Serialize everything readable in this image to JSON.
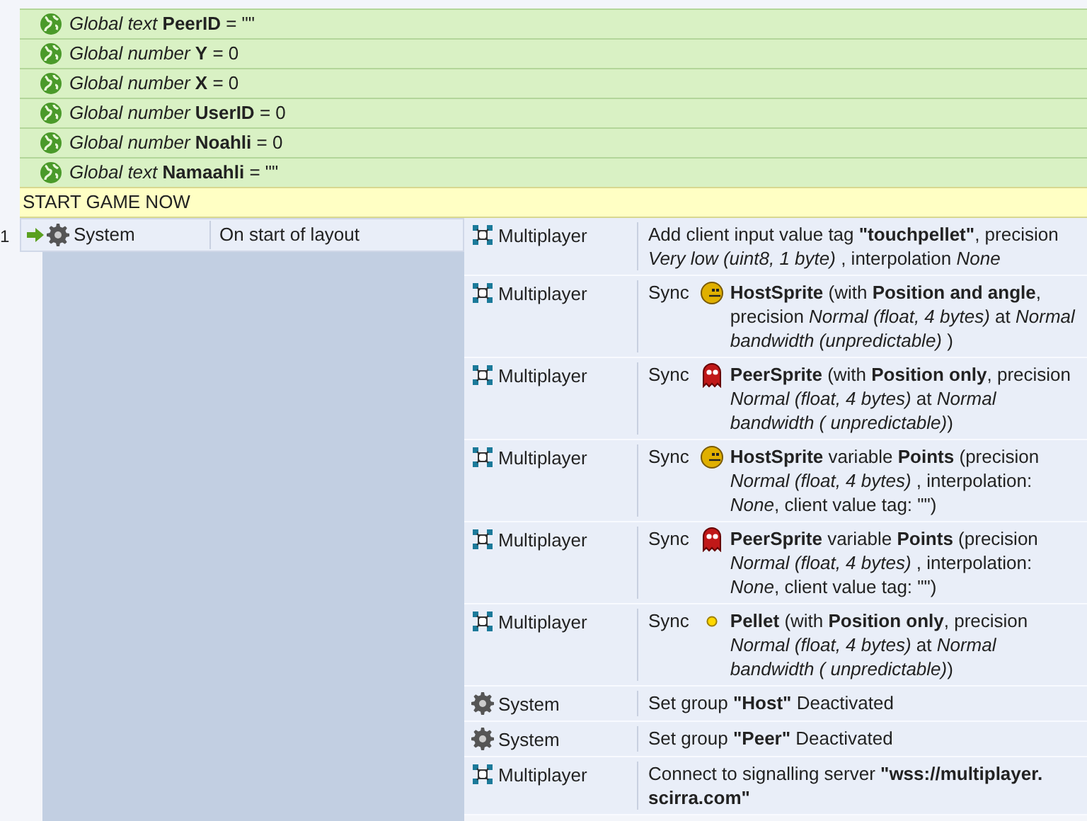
{
  "globals": [
    {
      "text": "*Global text* **PeerID** = \"\""
    },
    {
      "text": "*Global number* **Y** = 0"
    },
    {
      "text": "*Global number* **X** = 0"
    },
    {
      "text": "*Global number* **UserID** = 0"
    },
    {
      "text": "*Global number* **Noahli** = 0"
    },
    {
      "text": "*Global text* **Namaahli** = \"\""
    }
  ],
  "comment": "START GAME NOW",
  "event": {
    "number": "1",
    "condition": {
      "object": "System",
      "object_icon": {
        "kind": "system"
      },
      "text": "On start of layout"
    },
    "actions": [
      {
        "object": "Multiplayer",
        "object_icon": {
          "kind": "multiplayer"
        },
        "text": "Add client input value tag **\"touchpellet\"**, precision *Very low (uint8, 1 byte)* , interpolation *None*"
      },
      {
        "object": "Multiplayer",
        "object_icon": {
          "kind": "multiplayer"
        },
        "prefix": "Sync",
        "sprite": {
          "kind": "host"
        },
        "text": "**HostSprite** (with **Position and angle**, precision *Normal (float, 4 bytes)*  at *Normal bandwidth (unpredictable)* )"
      },
      {
        "object": "Multiplayer",
        "object_icon": {
          "kind": "multiplayer"
        },
        "prefix": "Sync",
        "sprite": {
          "kind": "peer"
        },
        "text": "**PeerSprite** (with **Position only**, precision *Normal (float, 4 bytes)*  at *Normal bandwidth ( unpredictable)*)"
      },
      {
        "object": "Multiplayer",
        "object_icon": {
          "kind": "multiplayer"
        },
        "prefix": "Sync",
        "sprite": {
          "kind": "host"
        },
        "text": "**HostSprite** variable **Points** (precision *Normal (float, 4 bytes)* , interpolation: *None*, client value tag: \"\")"
      },
      {
        "object": "Multiplayer",
        "object_icon": {
          "kind": "multiplayer"
        },
        "prefix": "Sync",
        "sprite": {
          "kind": "peer"
        },
        "text": "**PeerSprite** variable **Points** (precision *Normal (float, 4 bytes)* , interpolation: *None*, client value tag: \"\")"
      },
      {
        "object": "Multiplayer",
        "object_icon": {
          "kind": "multiplayer"
        },
        "prefix": "Sync",
        "sprite": {
          "kind": "pellet"
        },
        "text": "**Pellet** (with **Position only**, precision *Normal (float, 4 bytes)*  at *Normal bandwidth ( unpredictable)*)"
      },
      {
        "object": "System",
        "object_icon": {
          "kind": "system"
        },
        "text": "Set group **\"Host\"** Deactivated"
      },
      {
        "object": "System",
        "object_icon": {
          "kind": "system"
        },
        "text": "Set group **\"Peer\"** Deactivated"
      },
      {
        "object": "Multiplayer",
        "object_icon": {
          "kind": "multiplayer"
        },
        "text": "Connect to signalling server **\"wss://multiplayer. scirra.com\"**"
      }
    ]
  }
}
